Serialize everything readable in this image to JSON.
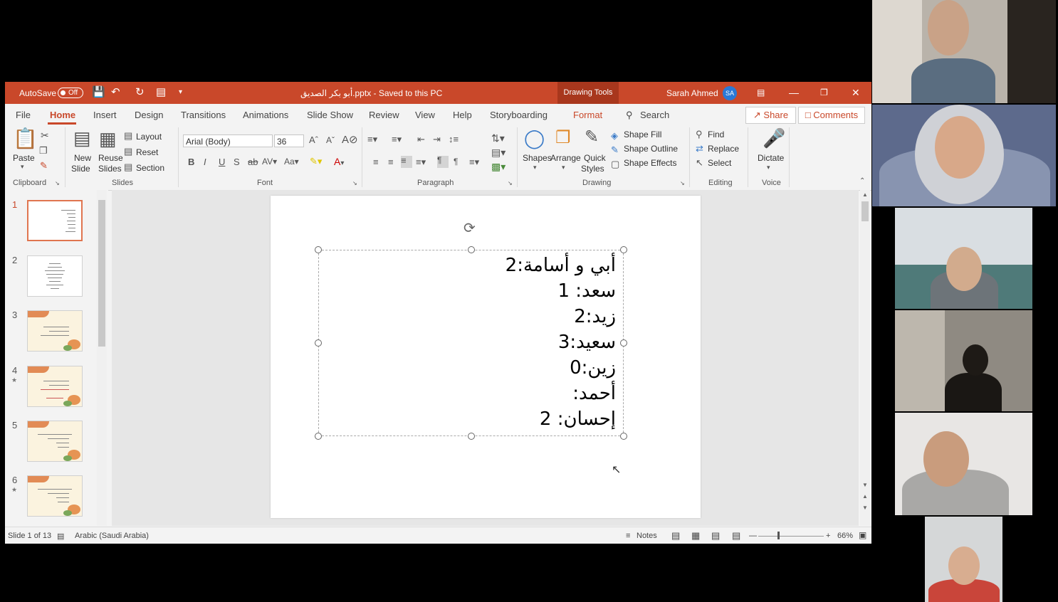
{
  "titlebar": {
    "autosave_label": "AutoSave",
    "autosave_state": "Off",
    "document_title": "أبو بكر الصديق.pptx  -  Saved to this PC",
    "drawing_tools": "Drawing Tools",
    "user_name": "Sarah Ahmed",
    "user_initials": "SA"
  },
  "tabs": [
    "File",
    "Home",
    "Insert",
    "Design",
    "Transitions",
    "Animations",
    "Slide Show",
    "Review",
    "View",
    "Help",
    "Storyboarding",
    "Format"
  ],
  "search_label": "Search",
  "share_label": "Share",
  "comments_label": "Comments",
  "ribbon": {
    "clipboard": {
      "paste": "Paste",
      "label": "Clipboard"
    },
    "slides": {
      "new_slide_1": "New",
      "new_slide_2": "Slide",
      "reuse_1": "Reuse",
      "reuse_2": "Slides",
      "layout": "Layout",
      "reset": "Reset",
      "section": "Section",
      "label": "Slides"
    },
    "font": {
      "name": "Arial (Body)",
      "size": "36",
      "label": "Font"
    },
    "paragraph": {
      "label": "Paragraph"
    },
    "drawing": {
      "shapes": "Shapes",
      "arrange": "Arrange",
      "quick_1": "Quick",
      "quick_2": "Styles",
      "shape_fill": "Shape Fill",
      "shape_outline": "Shape Outline",
      "shape_effects": "Shape Effects",
      "label": "Drawing"
    },
    "editing": {
      "find": "Find",
      "replace": "Replace",
      "select": "Select",
      "label": "Editing"
    },
    "voice": {
      "dictate": "Dictate",
      "label": "Voice"
    }
  },
  "thumbnails": [
    "1",
    "2",
    "3",
    "4",
    "5",
    "6"
  ],
  "slide_lines": [
    "أبي و أسامة:2",
    "سعد: 1",
    "زيد:2",
    "سعيد:3",
    "زين:0",
    "أحمد:",
    "إحسان: 2"
  ],
  "status": {
    "slide_info": "Slide 1 of 13",
    "language": "Arabic (Saudi Arabia)",
    "notes": "Notes",
    "zoom": "66%"
  },
  "colors": {
    "accent": "#c9482a",
    "title_bar": "#c9482a",
    "drawing_tools": "#a8371d"
  }
}
